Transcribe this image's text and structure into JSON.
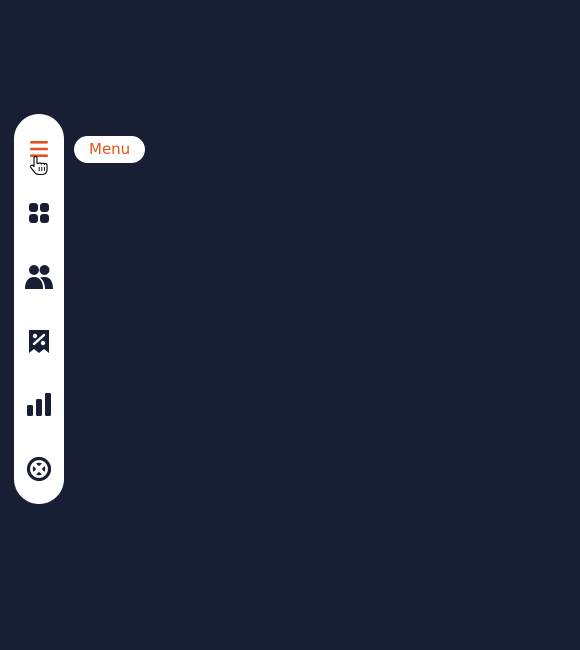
{
  "sidebar": {
    "items": [
      {
        "id": "menu",
        "icon": "hamburger-menu-icon",
        "active": true
      },
      {
        "id": "dashboard",
        "icon": "grid-icon",
        "active": false
      },
      {
        "id": "users",
        "icon": "users-icon",
        "active": false
      },
      {
        "id": "discounts",
        "icon": "discount-receipt-icon",
        "active": false
      },
      {
        "id": "analytics",
        "icon": "bar-chart-icon",
        "active": false
      },
      {
        "id": "support",
        "icon": "lifebuoy-icon",
        "active": false
      }
    ]
  },
  "tooltip": {
    "label": "Menu"
  },
  "colors": {
    "background": "#181f34",
    "sidebar": "#ffffff",
    "accent": "#e2531f",
    "icon": "#181f34"
  }
}
